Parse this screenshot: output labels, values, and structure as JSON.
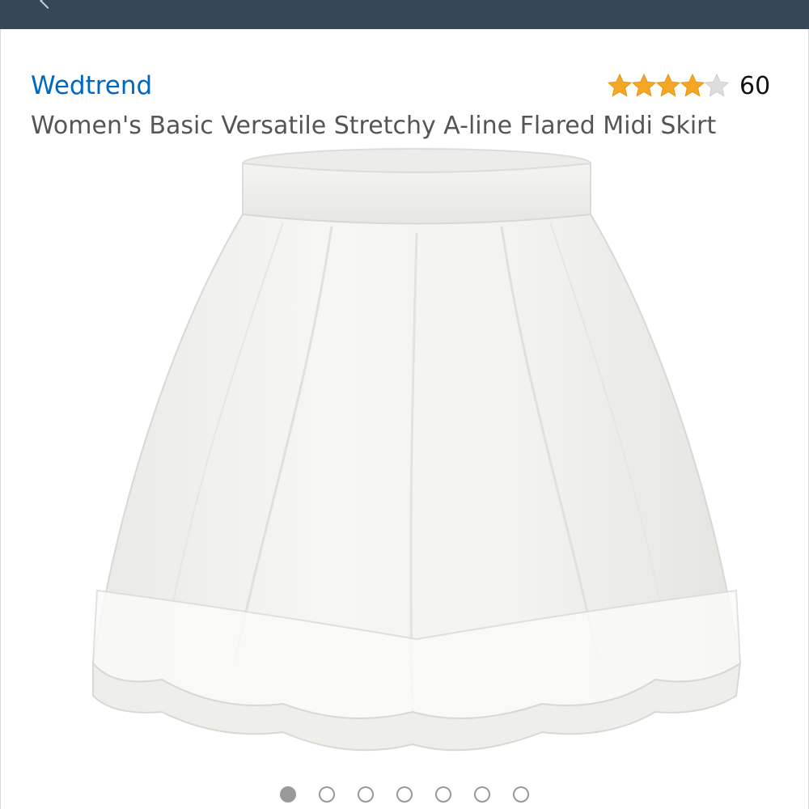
{
  "product": {
    "brand": "Wedtrend",
    "title": "Women's Basic Versatile Stretchy A-line Flared Midi Skirt",
    "rating": {
      "stars_filled": 4,
      "stars_total": 5,
      "count": "60"
    }
  },
  "image_carousel": {
    "total_images": 7,
    "active_index": 0
  },
  "colors": {
    "top_bar": "#37475a",
    "brand_link": "#0066c0",
    "star_filled": "#f5a623",
    "star_empty": "#dddddd"
  },
  "icons": {
    "back": "chevron-left-icon",
    "star": "star-icon"
  }
}
